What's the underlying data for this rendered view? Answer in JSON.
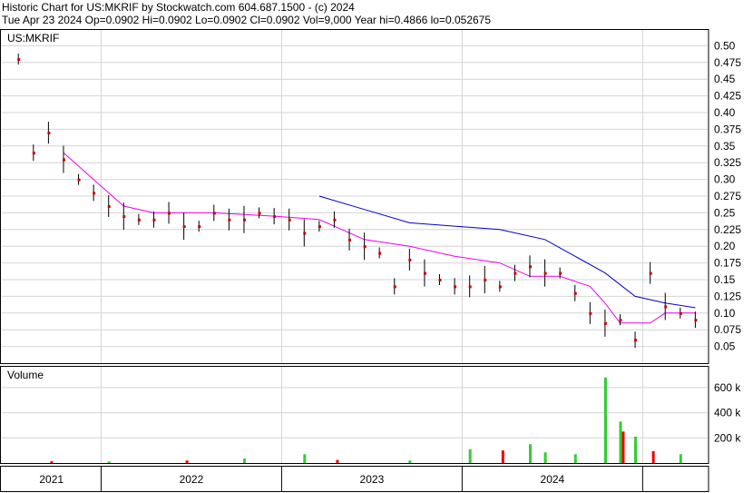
{
  "header": {
    "line1": "Historic Chart for US:MKRIF by Stockwatch.com 604.687.1500 - (c) 2024",
    "line2": "Tue Apr 23 2024   Op=0.0902   Hi=0.0902   Lo=0.0902   Cl=0.0902   Vol=9,000   Year hi=0.4866   lo=0.052675"
  },
  "colors": {
    "price_tick": "#cc0000",
    "price_range": "#000000",
    "ma_long": "#0000cc",
    "ma_short": "#ee00ee",
    "vol_up": "#33cc33",
    "vol_down": "#ee0000",
    "grid": "#d4d4d4",
    "frame": "#000000"
  },
  "chart_data": [
    {
      "type": "line",
      "panel": "price",
      "label": "US:MKRIF",
      "ylim": [
        0.025,
        0.525
      ],
      "y_ticks": [
        "0.50",
        "0.475",
        "0.45",
        "0.425",
        "0.40",
        "0.375",
        "0.35",
        "0.325",
        "0.30",
        "0.275",
        "0.25",
        "0.225",
        "0.20",
        "0.175",
        "0.15",
        "0.125",
        "0.10",
        "0.075",
        "0.05"
      ],
      "x_labels": [
        "2021",
        "2022",
        "2023",
        "2024"
      ],
      "grid": "on",
      "series": [
        {
          "role": "close",
          "points": [
            [
              "2020-07",
              0.48
            ],
            [
              "2020-08",
              0.34
            ],
            [
              "2020-09",
              0.37
            ],
            [
              "2020-10",
              0.33
            ],
            [
              "2020-11",
              0.3
            ],
            [
              "2020-12",
              0.28
            ],
            [
              "2021-01",
              0.26
            ],
            [
              "2021-02",
              0.245
            ],
            [
              "2021-03",
              0.24
            ],
            [
              "2021-04",
              0.24
            ],
            [
              "2021-05",
              0.25
            ],
            [
              "2021-06",
              0.23
            ],
            [
              "2021-07",
              0.23
            ],
            [
              "2021-08",
              0.25
            ],
            [
              "2021-09",
              0.24
            ],
            [
              "2021-10",
              0.24
            ],
            [
              "2021-11",
              0.25
            ],
            [
              "2021-12",
              0.245
            ],
            [
              "2022-01",
              0.24
            ],
            [
              "2022-02",
              0.22
            ],
            [
              "2022-03",
              0.23
            ],
            [
              "2022-04",
              0.24
            ],
            [
              "2022-05",
              0.21
            ],
            [
              "2022-06",
              0.2
            ],
            [
              "2022-07",
              0.19
            ],
            [
              "2022-08",
              0.14
            ],
            [
              "2022-09",
              0.18
            ],
            [
              "2022-10",
              0.16
            ],
            [
              "2022-11",
              0.15
            ],
            [
              "2022-12",
              0.14
            ],
            [
              "2023-01",
              0.14
            ],
            [
              "2023-02",
              0.15
            ],
            [
              "2023-03",
              0.14
            ],
            [
              "2023-04",
              0.16
            ],
            [
              "2023-05",
              0.17
            ],
            [
              "2023-06",
              0.16
            ],
            [
              "2023-07",
              0.16
            ],
            [
              "2023-08",
              0.13
            ],
            [
              "2023-09",
              0.1
            ],
            [
              "2023-10",
              0.085
            ],
            [
              "2023-11",
              0.09
            ],
            [
              "2023-12",
              0.06
            ],
            [
              "2024-01",
              0.16
            ],
            [
              "2024-02",
              0.11
            ],
            [
              "2024-03",
              0.1
            ],
            [
              "2024-04",
              0.09
            ]
          ]
        },
        {
          "role": "moving-average-long",
          "points": [
            [
              "2022-03",
              0.275
            ],
            [
              "2022-06",
              0.255
            ],
            [
              "2022-09",
              0.235
            ],
            [
              "2022-12",
              0.23
            ],
            [
              "2023-03",
              0.225
            ],
            [
              "2023-06",
              0.21
            ],
            [
              "2023-08",
              0.185
            ],
            [
              "2023-10",
              0.16
            ],
            [
              "2023-12",
              0.125
            ],
            [
              "2024-02",
              0.115
            ],
            [
              "2024-04",
              0.108
            ]
          ]
        },
        {
          "role": "moving-average-short",
          "points": [
            [
              "2020-10",
              0.34
            ],
            [
              "2020-12",
              0.3
            ],
            [
              "2021-02",
              0.26
            ],
            [
              "2021-04",
              0.25
            ],
            [
              "2021-08",
              0.25
            ],
            [
              "2021-12",
              0.245
            ],
            [
              "2022-03",
              0.24
            ],
            [
              "2022-06",
              0.21
            ],
            [
              "2022-09",
              0.2
            ],
            [
              "2022-12",
              0.185
            ],
            [
              "2023-03",
              0.175
            ],
            [
              "2023-05",
              0.155
            ],
            [
              "2023-07",
              0.155
            ],
            [
              "2023-09",
              0.14
            ],
            [
              "2023-10",
              0.115
            ],
            [
              "2023-11",
              0.085
            ],
            [
              "2024-01",
              0.085
            ],
            [
              "2024-02",
              0.1
            ],
            [
              "2024-04",
              0.1
            ]
          ]
        }
      ]
    },
    {
      "type": "bar",
      "panel": "volume",
      "label": "Volume",
      "ylim": [
        0,
        700
      ],
      "unit": "k",
      "y_ticks": [
        "600 k",
        "400 k",
        "200 k"
      ],
      "bars": [
        [
          "2020-09",
          15,
          "down"
        ],
        [
          "2021-01",
          12,
          "up"
        ],
        [
          "2021-06",
          20,
          "down"
        ],
        [
          "2021-10",
          35,
          "up"
        ],
        [
          "2022-02",
          70,
          "up"
        ],
        [
          "2022-04",
          25,
          "down"
        ],
        [
          "2022-09",
          20,
          "up"
        ],
        [
          "2023-01",
          110,
          "up"
        ],
        [
          "2023-03",
          100,
          "down"
        ],
        [
          "2023-05",
          150,
          "up"
        ],
        [
          "2023-06",
          85,
          "up"
        ],
        [
          "2023-08",
          70,
          "up"
        ],
        [
          "2023-10",
          680,
          "up"
        ],
        [
          "2023-10",
          380,
          "up"
        ],
        [
          "2023-11",
          250,
          "down"
        ],
        [
          "2023-11",
          330,
          "up"
        ],
        [
          "2023-12",
          210,
          "up"
        ],
        [
          "2023-12",
          140,
          "up"
        ],
        [
          "2024-01",
          95,
          "down"
        ],
        [
          "2024-03",
          70,
          "up"
        ]
      ]
    }
  ]
}
